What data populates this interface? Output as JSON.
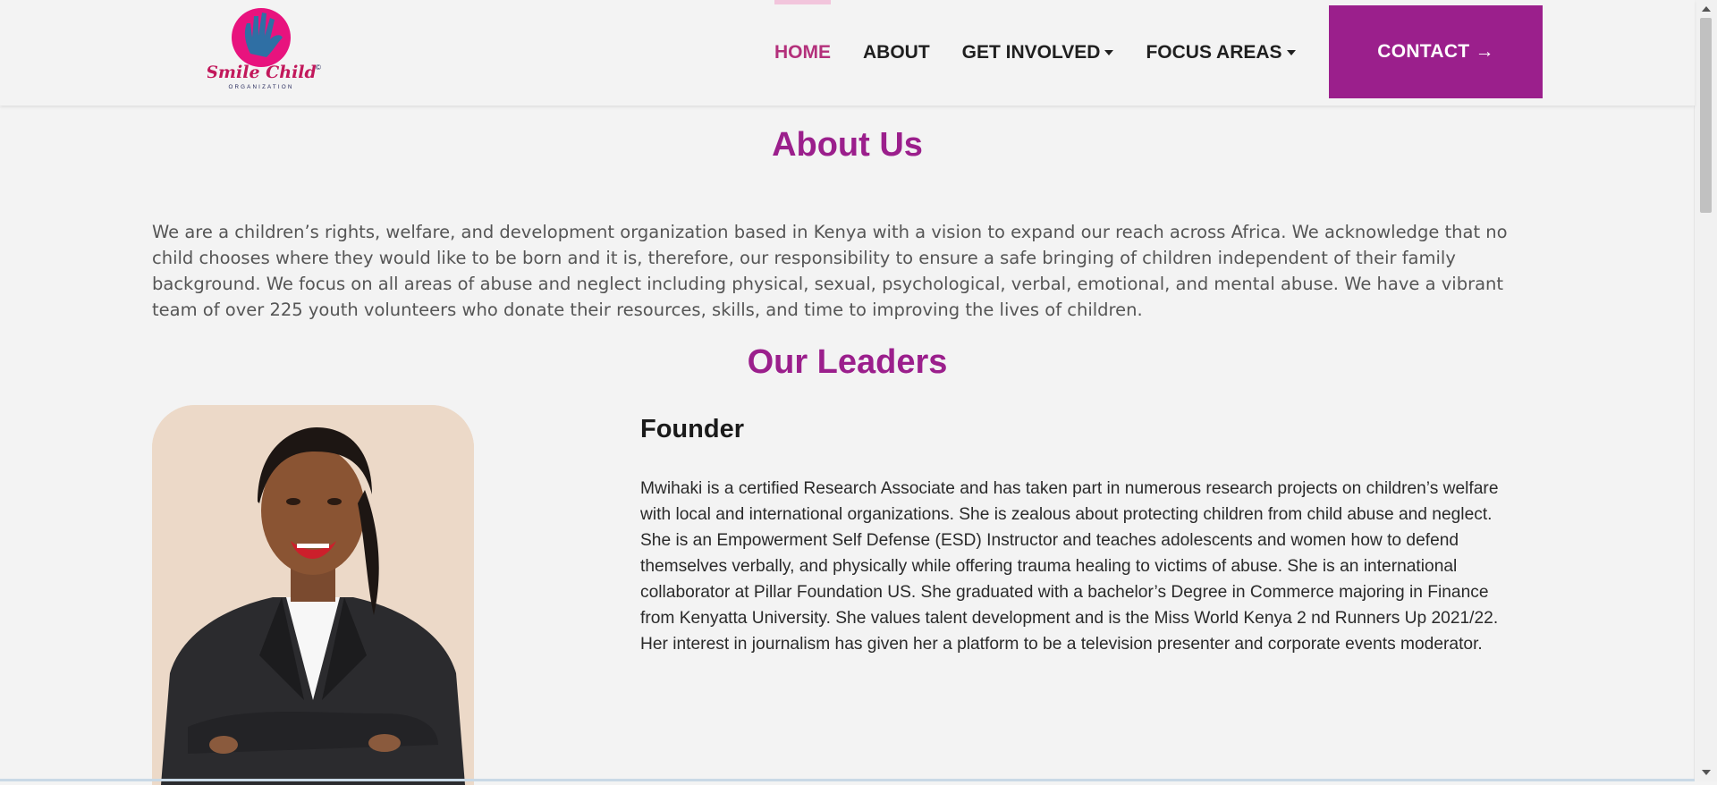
{
  "brand": {
    "logo_title": "Smile Child",
    "logo_subtitle": "ORGANIZATION",
    "logo_mark": "©",
    "colors": {
      "primary": "#9b1f8c",
      "active": "#b3307b",
      "logo_pink": "#e8137e",
      "hand_blue": "#2f6fa4",
      "text_navy": "#24285a"
    }
  },
  "nav": {
    "items": [
      {
        "label": "HOME",
        "active": true,
        "dropdown": false
      },
      {
        "label": "ABOUT",
        "active": false,
        "dropdown": false
      },
      {
        "label": "GET INVOLVED",
        "active": false,
        "dropdown": true
      },
      {
        "label": "FOCUS AREAS",
        "active": false,
        "dropdown": true
      }
    ],
    "contact_label": "CONTACT",
    "contact_icon": "arrow-right-icon"
  },
  "about": {
    "title": "About Us",
    "text": "We are a children’s rights, welfare, and development organization based in Kenya with a vision to expand our reach across Africa. We acknowledge that no child chooses where they would like to be born and it is, therefore, our responsibility to ensure a safe bringing of children independent of their family background. We focus on all areas of abuse and neglect including physical, sexual, psychological, verbal, emotional, and mental abuse. We have a vibrant team of over 225 youth volunteers who donate their resources, skills, and time to improving the lives of children."
  },
  "leaders": {
    "title": "Our Leaders",
    "items": [
      {
        "role": "Founder",
        "bio": "Mwihaki is a certified Research Associate and has taken part in numerous research projects on children’s welfare with local and international organizations. She is zealous about protecting children from child abuse and neglect. She is an Empowerment Self Defense (ESD) Instructor and teaches adolescents and women how to defend themselves verbally, and physically while offering trauma healing to victims of abuse. She is an international collaborator at Pillar Foundation US. She graduated with a bachelor’s Degree in Commerce majoring in Finance from Kenyatta University. She values talent development and is the Miss World Kenya 2 nd Runners Up 2021/22. Her interest in journalism has given her a platform to be a television presenter and corporate events moderator."
      }
    ]
  }
}
